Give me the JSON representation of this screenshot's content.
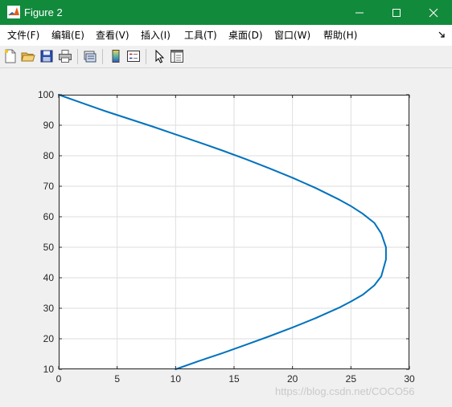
{
  "window": {
    "title": "Figure 2",
    "icon": "matlab-icon",
    "controls": [
      "minimize-icon",
      "maximize-icon",
      "close-icon"
    ]
  },
  "menu": {
    "items": [
      "文件(F)",
      "编辑(E)",
      "查看(V)",
      "插入(I)",
      "工具(T)",
      "桌面(D)",
      "窗口(W)",
      "帮助(H)"
    ]
  },
  "toolbar": {
    "buttons": [
      "new-figure-icon",
      "open-file-icon",
      "save-icon",
      "print-icon",
      "link-plot-icon",
      "insert-colorbar-icon",
      "insert-legend-icon",
      "edit-plot-icon",
      "property-inspector-icon"
    ]
  },
  "chart_data": {
    "type": "line",
    "title": "",
    "xlabel": "",
    "ylabel": "",
    "xlim": [
      0,
      30
    ],
    "ylim": [
      10,
      100
    ],
    "xticks": [
      0,
      5,
      10,
      15,
      20,
      25,
      30
    ],
    "yticks": [
      10,
      20,
      30,
      40,
      50,
      60,
      70,
      80,
      90,
      100
    ],
    "grid": true,
    "colors": {
      "line": "#0072bd",
      "axes_bg": "#ffffff",
      "grid": "#dedede"
    },
    "series": [
      {
        "x": [
          10,
          12,
          14,
          16,
          18,
          20,
          22,
          24,
          25,
          26,
          27,
          27.6,
          28,
          28,
          27.6,
          27,
          26,
          25,
          24,
          22,
          20,
          18,
          16,
          14,
          12,
          10,
          8,
          6,
          4,
          2,
          0
        ],
        "y": [
          10,
          12.7,
          15.3,
          18.0,
          20.8,
          23.7,
          26.8,
          30.2,
          32.2,
          34.4,
          37.5,
          40.5,
          46.0,
          50.0,
          54.5,
          58.0,
          61.0,
          63.5,
          65.6,
          69.4,
          72.8,
          75.9,
          78.9,
          81.7,
          84.4,
          87.0,
          89.6,
          92.1,
          94.6,
          97.3,
          100
        ]
      }
    ]
  },
  "watermark": "https://blog.csdn.net/COCO56"
}
